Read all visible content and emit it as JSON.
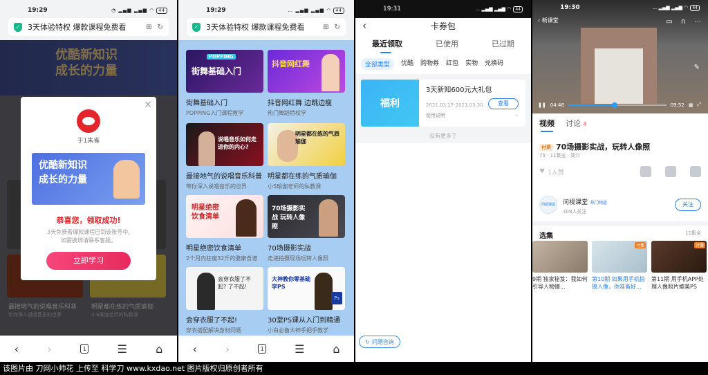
{
  "panel1": {
    "status_time": "19:29",
    "battery": "44",
    "address_text": "3天体验特权 爆款课程免费看",
    "banner_text_1": "优酷新知识",
    "banner_text_2": "成长的力量",
    "bg_labels": [
      "最接地气的说唱音乐科普",
      "明星都在练的气质瑜伽",
      "带你深入说唱音乐的世界",
      "小S瑜伽老师的私教课"
    ],
    "modal": {
      "avatar_name": "于1朱雀",
      "banner_1": "优酷新知识",
      "banner_2": "成长的力量",
      "success": "恭喜您，领取成功!",
      "desc_1": "3天免费看爆款课程已到该账号中,",
      "desc_2": "如需换绑请联系客服。",
      "button": "立即学习"
    }
  },
  "panel2": {
    "status_time": "19:29",
    "battery": "44",
    "address_text": "3天体验特权 爆款课程免费看",
    "courses": [
      {
        "title": "街舞基础入门",
        "sub": "POPPING入门课程教学",
        "img_text": "街舞基础入门",
        "tag": "POPPING"
      },
      {
        "title": "抖音网红舞 边跳边瘦",
        "sub": "热门舞蹈特权学",
        "img_text": "抖音网红舞",
        "tag": ""
      },
      {
        "title": "最接地气的说唱音乐科普",
        "sub": "带你深入说唱音乐的世界",
        "img_text": "说唱音乐如何走进你的内心?",
        "tag": ""
      },
      {
        "title": "明星都在练的气质瑜伽",
        "sub": "小S瑜伽老师的私教课",
        "img_text": "明星都在练的气质瑜伽",
        "tag": ""
      },
      {
        "title": "明星绝密饮食清单",
        "sub": "2个月内狂瘦32斤的健康食谱",
        "img_text": "明星绝密 饮食清单",
        "tag": ""
      },
      {
        "title": "70场摄影实战",
        "sub": "走进拍摄现场玩转人像照",
        "img_text": "70场摄影实战 玩转人像照",
        "tag": ""
      },
      {
        "title": "会穿衣服了不起!",
        "sub": "穿衣搭配解决身材问题",
        "img_text": "会穿衣服了不起? 了不起!",
        "tag": ""
      },
      {
        "title": "30堂PS课从入门到精通",
        "sub": "小白必备大神手把手教学",
        "img_text": "大神教你零基础学PS",
        "tag": ""
      }
    ],
    "help_button": "问题咨询"
  },
  "panel3": {
    "status_time": "19:31",
    "battery": "44",
    "title": "卡券包",
    "tabs": [
      "最近领取",
      "已使用",
      "已过期"
    ],
    "categories": [
      "全部类型",
      "优酷",
      "购物券",
      "红包",
      "实物",
      "兑换码"
    ],
    "coupon": {
      "left": "福利",
      "title": "3天新知600元大礼包",
      "date": "2021.03.27-2021.03.30",
      "usage": "使用说明",
      "button": "查看"
    },
    "no_more": "没有更多了"
  },
  "panel4": {
    "status_time": "19:30",
    "battery": "44",
    "video_source": "新课堂",
    "time_current": "04:46",
    "time_total": "09:52",
    "progress": 0.47,
    "tabs": {
      "video": "视频",
      "discuss": "讨论",
      "discuss_count": "4"
    },
    "paid_tag": "付费",
    "title": "70场摄影实战，玩转人像照",
    "meta": "75 · 11集全 · 简介",
    "likes": "1人赞",
    "author": {
      "avatar_text": "问视课堂",
      "name": "问视课堂",
      "badge": "热门频道",
      "followers": "408人关注",
      "follow": "关注"
    },
    "selection": {
      "label": "选集",
      "all": "11集全"
    },
    "episodes": [
      {
        "title": "9期 独家秘笈：我如何引导人物情...",
        "paid": "",
        "active": false
      },
      {
        "title": "第10期 如果用手机拍摄人像，你准备好...",
        "paid": "付费",
        "active": true
      },
      {
        "title": "第11期 用手机APP处理人像照片媲美PS",
        "paid": "付费",
        "active": false
      }
    ]
  },
  "footer_text": "该图片由 刀网小帅花 上传至 科学刀 www.kxdao.net 图片版权归原创者所有"
}
